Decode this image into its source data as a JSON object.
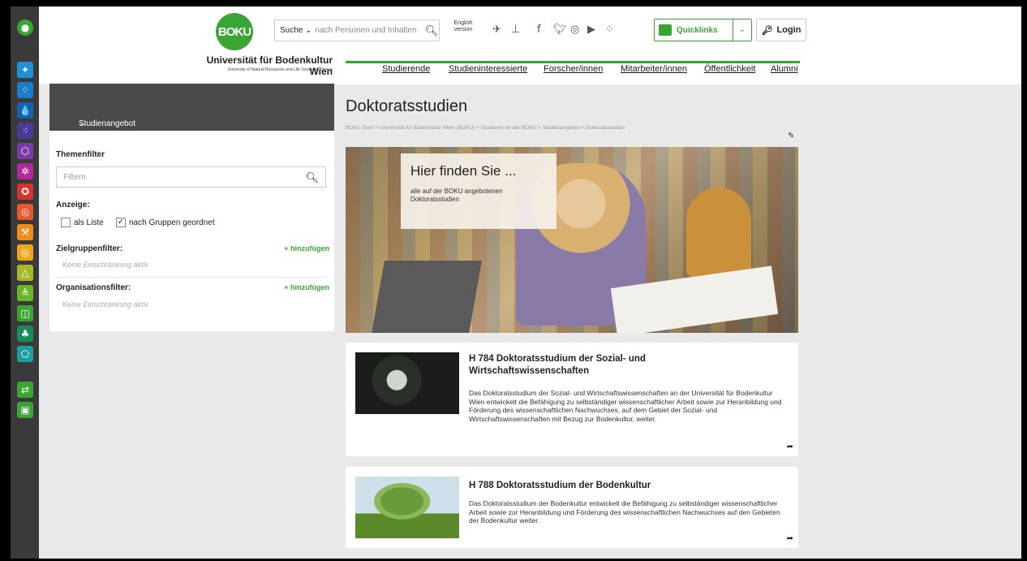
{
  "header": {
    "logo_text": "BOKU",
    "university_name": "Universität für Bodenkultur Wien",
    "university_subtitle": "University of Natural Resources and Life Sciences, Vienna",
    "search_select": "Suche",
    "search_placeholder": "nach Personen und Inhalten",
    "english_label": "English version",
    "quicklinks_label": "Quicklinks",
    "login_label": "Login",
    "nav": [
      "Studierende",
      "Studieninteressierte",
      "Forscher/innen",
      "Mitarbeiter/innen",
      "Öffentlichkeit",
      "Alumni"
    ]
  },
  "sidebar": {
    "back_label": "Studienangebot",
    "themenfilter_label": "Themenfilter",
    "filter_placeholder": "Filtern",
    "anzeige_label": "Anzeige:",
    "als_liste_label": "als Liste",
    "nach_gruppen_label": "nach Gruppen geordnet",
    "zielgruppen_label": "Zielgruppenfilter:",
    "add_label": "+ hinzufügen",
    "none_label": "Keine Einschränkung aktiv",
    "organisation_label": "Organisationsfilter:"
  },
  "main": {
    "title": "Doktoratsstudien",
    "breadcrumb": "BOKU-Start > Universität für Bodenkultur Wien (BOKU) > Studieren an der BOKU > Studienangebot > Doktoratsstudien",
    "hero_heading": "Hier finden Sie ...",
    "hero_text": "alle auf der BOKU angebotenen Doktoratsstudien",
    "cards": [
      {
        "title": "H 784 Doktoratsstudium der Sozial- und Wirtschaftswissenschaften",
        "desc": "Das Doktoratsstudium der Sozial- und Wirtschaftswissenschaften an der Universität für Bodenkultur Wien entwickelt die Befähigung zu selbständiger wissenschaftlicher Arbeit sowie zur Heranbildung und Förderung des wissenschaftlichen Nachwuchses, auf dem Gebiet der Sozial- und Wirtschaftswissenschaften mit Bezug zur Bodenkultur, weiter."
      },
      {
        "title": "H 788 Doktoratsstudium der Bodenkultur",
        "desc": "Das Doktoratsstudium der Bodenkultur entwickelt die Befähigung zu selbständiger wissenschaftlicher Arbeit sowie zur Heranbildung und Förderung des wissenschaftlichen Nachwuchses auf den Gebieten der Bodenkultur weiter."
      }
    ]
  },
  "rail_icons": [
    {
      "name": "boku-home-icon",
      "color": "#3aa534"
    },
    {
      "name": "cell-icon",
      "color": "#1e90d6"
    },
    {
      "name": "dots-icon",
      "color": "#1a7fc8"
    },
    {
      "name": "drops-icon",
      "color": "#1760b0"
    },
    {
      "name": "scatter-icon",
      "color": "#4a3a9a"
    },
    {
      "name": "hexagon-icon",
      "color": "#7a3aa8"
    },
    {
      "name": "molecule-icon",
      "color": "#b02a9a"
    },
    {
      "name": "wheel-icon",
      "color": "#d9322a"
    },
    {
      "name": "target-icon",
      "color": "#e8562a"
    },
    {
      "name": "tools-icon",
      "color": "#f08a1a"
    },
    {
      "name": "spiral-icon",
      "color": "#f0a51a"
    },
    {
      "name": "triangle-icon",
      "color": "#a8b82a"
    },
    {
      "name": "stack-icon",
      "color": "#6ab42a"
    },
    {
      "name": "leaf-icon",
      "color": "#3aa534"
    },
    {
      "name": "tree-icon",
      "color": "#1a8a5a"
    },
    {
      "name": "polygon-icon",
      "color": "#1aa0a0"
    },
    {
      "name": "transfer-icon",
      "color": "#3aa534"
    },
    {
      "name": "bookmark-icon",
      "color": "#3aa534"
    }
  ],
  "colors": {
    "brand_green": "#3aa534"
  }
}
